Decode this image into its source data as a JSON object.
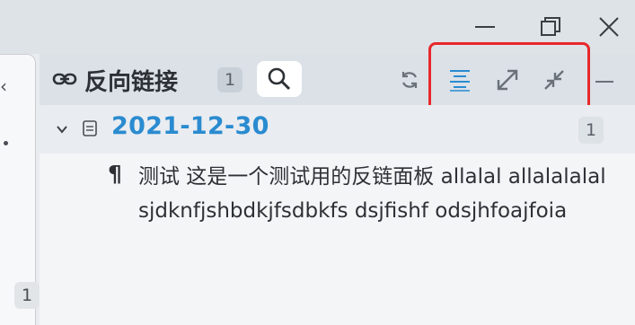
{
  "window": {
    "minimize_label": "minimize",
    "maximize_label": "maximize",
    "close_label": "close"
  },
  "left_panel": {
    "arrow": "‹",
    "badge": "1"
  },
  "panel": {
    "title": "反向链接",
    "count": "1",
    "toolbar": {
      "search": "search-icon",
      "refresh": "refresh-icon",
      "expand_level": "expand-level-icon",
      "expand_all": "expand-all-icon",
      "collapse_all": "collapse-all-icon",
      "more": "minus-icon"
    },
    "highlight_color": "#e8282a"
  },
  "document": {
    "title": "2021-12-30",
    "count": "1",
    "title_color": "#2a8bd0"
  },
  "paragraph": {
    "mark": "¶",
    "text": "测试 这是一个测试用的反链面板 allalal allalalalal sjdknfjshbdkjfsdbkfs dsjfishf odsjhfoajfoia"
  }
}
